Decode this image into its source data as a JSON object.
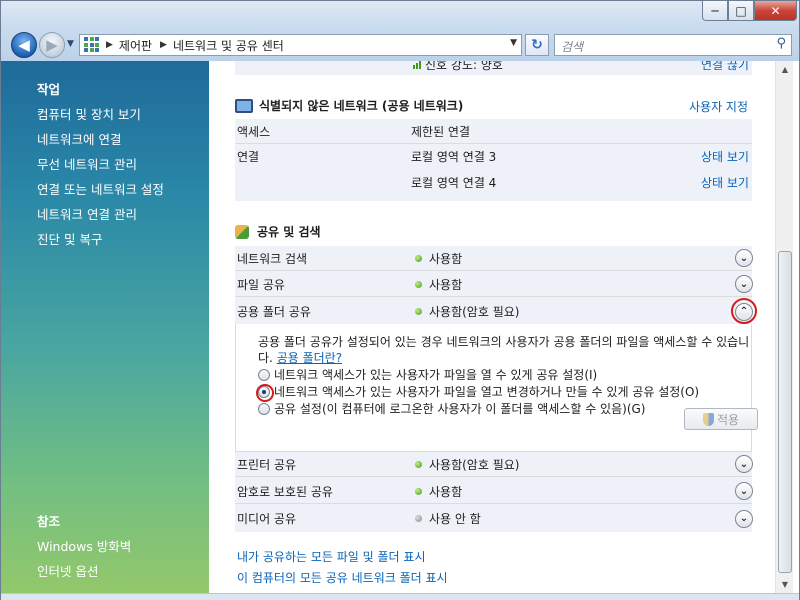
{
  "window": {
    "minimize": "─",
    "maximize": "□",
    "close": "✕"
  },
  "nav": {
    "back": "◀",
    "forward": "▶",
    "history": "▼",
    "crumbs": [
      "제어판",
      "네트워크 및 공유 센터"
    ],
    "refresh": "↻",
    "search_placeholder": "검색"
  },
  "sidebar": {
    "tasks_header": "작업",
    "tasks": [
      "컴퓨터 및 장치 보기",
      "네트워크에 연결",
      "무선 네트워크 관리",
      "연결 또는 네트워크 설정",
      "네트워크 연결 관리",
      "진단 및 복구"
    ],
    "see_also_header": "참조",
    "see_also": [
      "Windows 방화벽",
      "인터넷 옵션"
    ]
  },
  "network": {
    "signal_partial": "신호 강도: 양호",
    "disconnect_partial": "연결 끊기",
    "title": "식별되지 않은 네트워크 (공용 네트워크)",
    "customize": "사용자 지정",
    "rows": [
      {
        "label": "액세스",
        "value": "제한된 연결",
        "action": ""
      },
      {
        "label": "연결",
        "value": "로컬 영역 연결 3",
        "action": "상태 보기"
      },
      {
        "label": "",
        "value": "로컬 영역 연결 4",
        "action": "상태 보기"
      }
    ]
  },
  "sharing": {
    "title": "공유 및 검색",
    "rows_top": [
      {
        "label": "네트워크 검색",
        "status": "사용함",
        "on": true
      },
      {
        "label": "파일 공유",
        "status": "사용함",
        "on": true
      },
      {
        "label": "공용 폴더 공유",
        "status": "사용함(암호 필요)",
        "on": true
      }
    ],
    "panel": {
      "description": "공용 폴더 공유가 설정되어 있는 경우 네트워크의 사용자가 공용 폴더의 파일을 액세스할 수 있습니다.",
      "description_link": "공용 폴더란?",
      "options": [
        "네트워크 액세스가 있는 사용자가 파일을 열 수 있게 공유 설정(I)",
        "네트워크 액세스가 있는 사용자가 파일을 열고 변경하거나 만들 수 있게 공유 설정(O)",
        "공유 설정(이 컴퓨터에 로그온한 사용자가 이 폴더를 액세스할 수 있음)(G)"
      ],
      "selected": 1,
      "apply": "적용"
    },
    "rows_bottom": [
      {
        "label": "프린터 공유",
        "status": "사용함(암호 필요)",
        "on": true
      },
      {
        "label": "암호로 보호된 공유",
        "status": "사용함",
        "on": true
      },
      {
        "label": "미디어 공유",
        "status": "사용 안 함",
        "on": false
      }
    ]
  },
  "links": [
    "내가 공유하는 모든 파일 및 폴더 표시",
    "이 컴퓨터의 모든 공유 네트워크 폴더 표시"
  ],
  "colors": {
    "link": "#0a63b8",
    "highlight_ring": "#d41c1c",
    "status_on": "#3f9a12"
  }
}
